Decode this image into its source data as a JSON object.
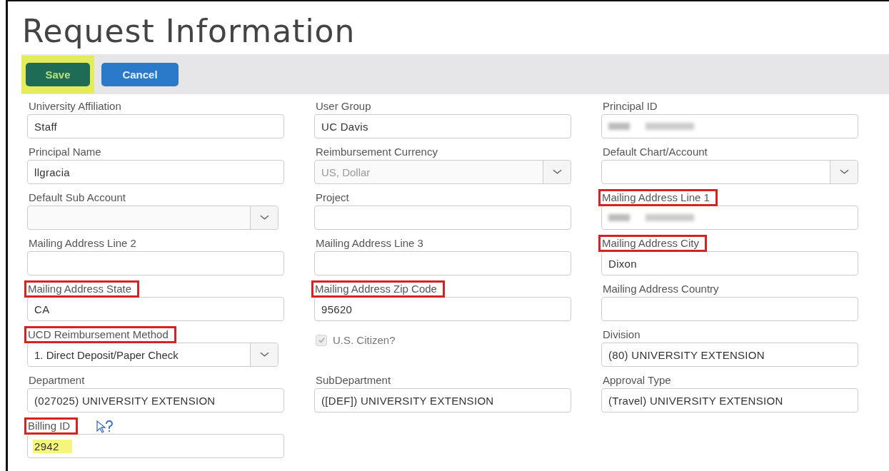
{
  "title": "Request Information",
  "toolbar": {
    "buttons": [
      {
        "label": "Save",
        "kind": "primary",
        "highlighted": true
      },
      {
        "label": "Cancel",
        "kind": "secondary",
        "highlighted": false
      }
    ]
  },
  "fields": [
    {
      "label": "University Affiliation",
      "kind": "text",
      "value": "Staff",
      "marked": false
    },
    {
      "label": "User Group",
      "kind": "text",
      "value": "UC Davis",
      "marked": false
    },
    {
      "label": "Principal ID",
      "kind": "text",
      "redacted": true,
      "marked": false
    },
    {
      "label": "Principal Name",
      "kind": "text",
      "value": "llgracia",
      "marked": false
    },
    {
      "label": "Reimbursement Currency",
      "kind": "select",
      "value": "US, Dollar",
      "disabled": true,
      "marked": false
    },
    {
      "label": "Default Chart/Account",
      "kind": "select",
      "marked": false
    },
    {
      "label": "Default Sub Account",
      "kind": "select",
      "disabled": true,
      "narrow": true,
      "marked": false
    },
    {
      "label": "Project",
      "kind": "text",
      "marked": false
    },
    {
      "label": "Mailing Address Line 1",
      "kind": "text",
      "redacted": true,
      "marked": true
    },
    {
      "label": "Mailing Address Line 2",
      "kind": "text",
      "marked": false
    },
    {
      "label": "Mailing Address Line 3",
      "kind": "text",
      "marked": false
    },
    {
      "label": "Mailing Address City",
      "kind": "text",
      "value": "Dixon",
      "marked": true
    },
    {
      "label": "Mailing Address State",
      "kind": "text",
      "value": "CA",
      "marked": true
    },
    {
      "label": "Mailing Address Zip Code",
      "kind": "text",
      "value": "95620",
      "marked": true
    },
    {
      "label": "Mailing Address Country",
      "kind": "text",
      "marked": false
    },
    {
      "label": "UCD Reimbursement Method",
      "kind": "select",
      "value": "1. Direct Deposit/Paper Check",
      "narrow": true,
      "marked": true
    },
    {
      "label": "U.S. Citizen?",
      "kind": "checkbox",
      "checked": true,
      "disabled": true
    },
    {
      "label": "Division",
      "kind": "text",
      "value": "(80) UNIVERSITY EXTENSION",
      "marked": false
    },
    {
      "label": "Department",
      "kind": "text",
      "value": "(027025) UNIVERSITY EXTENSION",
      "marked": false
    },
    {
      "label": "SubDepartment",
      "kind": "text",
      "value": "([DEF]) UNIVERSITY EXTENSION",
      "marked": false
    },
    {
      "label": "Approval Type",
      "kind": "text",
      "value": "(Travel) UNIVERSITY EXTENSION",
      "marked": false
    },
    {
      "label": "Billing ID",
      "kind": "text",
      "value": "2942",
      "marked": true,
      "highlighted": true,
      "cursor": true
    }
  ]
}
